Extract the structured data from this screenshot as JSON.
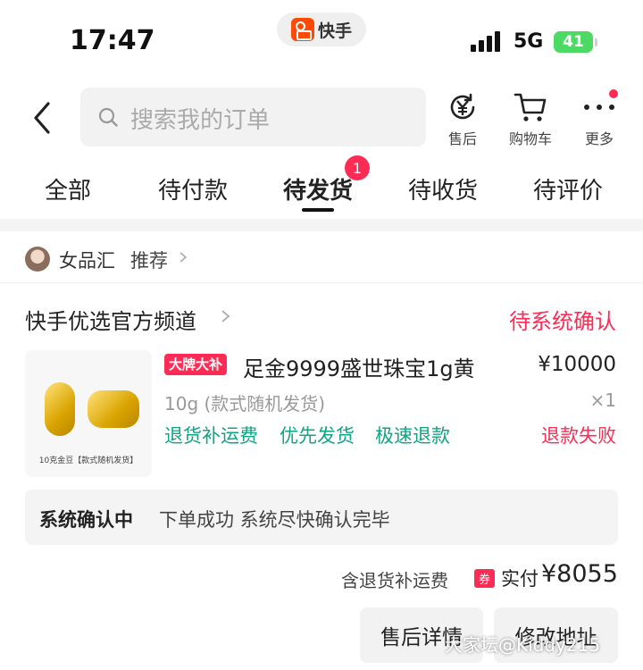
{
  "status_bar": {
    "time": "17:47",
    "app_name": "快手",
    "network": "5G",
    "battery": "41"
  },
  "header": {
    "search_placeholder": "搜索我的订单",
    "actions": [
      {
        "label": "售后",
        "icon": "yen-refresh-icon"
      },
      {
        "label": "购物车",
        "icon": "cart-icon"
      },
      {
        "label": "更多",
        "icon": "more-icon"
      }
    ]
  },
  "tabs": [
    {
      "label": "全部"
    },
    {
      "label": "待付款"
    },
    {
      "label": "待发货",
      "active": true,
      "badge": "1"
    },
    {
      "label": "待收货"
    },
    {
      "label": "待评价"
    }
  ],
  "recommend": {
    "shop": "女品汇",
    "label": "推荐"
  },
  "order": {
    "store": "快手优选官方频道",
    "status": "待系统确认",
    "product": {
      "badge": "大牌大补",
      "title": "足金9999盛世珠宝1g黄",
      "price": "¥10000",
      "spec": "10g (款式随机发货)",
      "qty": "×1",
      "thumb_caption": "10克金豆【款式随机发货】"
    },
    "services": [
      "退货补运费",
      "优先发货",
      "极速退款"
    ],
    "refund_status": "退款失败",
    "notice": {
      "title": "系统确认中",
      "text": "下单成功 系统尽快确认完毕"
    },
    "fee_label": "含退货补运费",
    "coupon": "券",
    "paid_label": "实付",
    "paid_amount": "¥8055",
    "buttons": [
      "售后详情",
      "修改地址"
    ]
  },
  "watermark": "大家坛@Kiddy215",
  "colors": {
    "accent": "#fe2c55",
    "service_green": "#0fa583",
    "battery_green": "#4cd964"
  }
}
